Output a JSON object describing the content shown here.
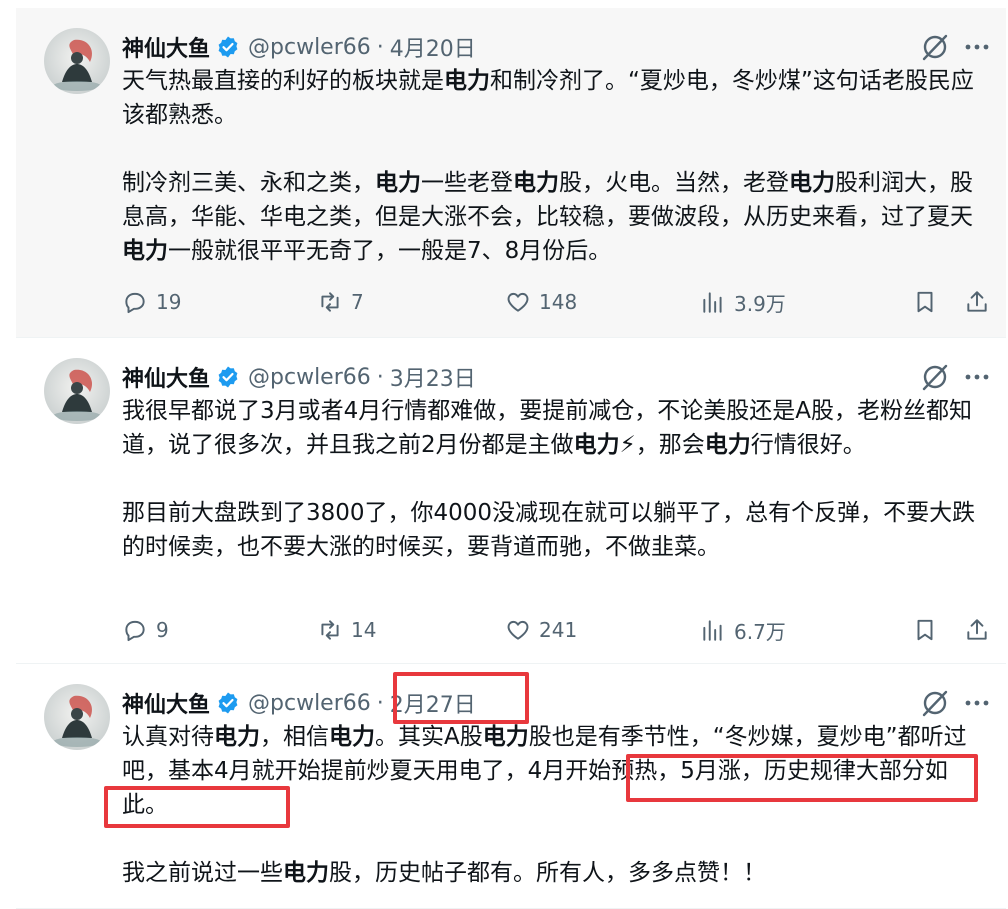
{
  "tweets": [
    {
      "name": "神仙大鱼",
      "handle": "@pcwler66",
      "sep": "·",
      "date": "4月20日",
      "paragraphs": [
        [
          {
            "t": "天气热最直接的利好的板块就是"
          },
          {
            "t": "电力",
            "b": true
          },
          {
            "t": "和制冷剂了。“夏炒电，冬炒煤”这句话老股民应该都熟悉。"
          }
        ],
        [
          {
            "t": "制冷剂三美、永和之类，"
          },
          {
            "t": "电力",
            "b": true
          },
          {
            "t": "一些老登"
          },
          {
            "t": "电力",
            "b": true
          },
          {
            "t": "股，火电。当然，老登"
          },
          {
            "t": "电力",
            "b": true
          },
          {
            "t": "股利润大，股息高，华能、华电之类，但是大涨不会，比较稳，要做波段，从历史来看，过了夏天"
          },
          {
            "t": "电力",
            "b": true
          },
          {
            "t": "一般就很平平无奇了，一般是7、8月份后。"
          }
        ]
      ],
      "replies": "19",
      "retweets": "7",
      "likes": "148",
      "views": "3.9万"
    },
    {
      "name": "神仙大鱼",
      "handle": "@pcwler66",
      "sep": "·",
      "date": "3月23日",
      "paragraphs": [
        [
          {
            "t": "我很早都说了3月或者4月行情都难做，要提前减仓，不论美股还是A股，老粉丝都知道，说了很多次，并且我之前2月份都是主做"
          },
          {
            "t": "电力",
            "b": true
          },
          {
            "t": "⚡，那会"
          },
          {
            "t": "电力",
            "b": true
          },
          {
            "t": "行情很好。"
          }
        ],
        [
          {
            "t": "那目前大盘跌到了3800了，你4000没减现在就可以躺平了，总有个反弹，不要大跌的时候卖，也不要大涨的时候买，要背道而驰，不做韭菜。"
          }
        ]
      ],
      "replies": "9",
      "retweets": "14",
      "likes": "241",
      "views": "6.7万"
    },
    {
      "name": "神仙大鱼",
      "handle": "@pcwler66",
      "sep": "·",
      "date": "2月27日",
      "paragraphs": [
        [
          {
            "t": "认真对待"
          },
          {
            "t": "电力",
            "b": true
          },
          {
            "t": "，相信"
          },
          {
            "t": "电力",
            "b": true
          },
          {
            "t": "。其实A股"
          },
          {
            "t": "电力",
            "b": true
          },
          {
            "t": "股也是有季节性，“冬炒媒，夏炒电”都听过吧，基本4月就开始提前炒夏天用电了，4月开始预热，5月涨，历史规律大部分如此。"
          }
        ],
        [
          {
            "t": "我之前说过一些"
          },
          {
            "t": "电力",
            "b": true
          },
          {
            "t": "股，历史帖子都有。所有人，多多点赞！！"
          }
        ]
      ]
    }
  ],
  "colors": {
    "text": "#0f1419",
    "muted": "#536471",
    "verified": "#1d9bf0",
    "highlight_box": "#e8383d",
    "hover_bg": "#f7f7f7"
  },
  "icons": [
    "verified-badge-icon",
    "grok-icon",
    "more-icon",
    "reply-icon",
    "retweet-icon",
    "like-icon",
    "views-icon",
    "bookmark-icon",
    "share-icon"
  ]
}
